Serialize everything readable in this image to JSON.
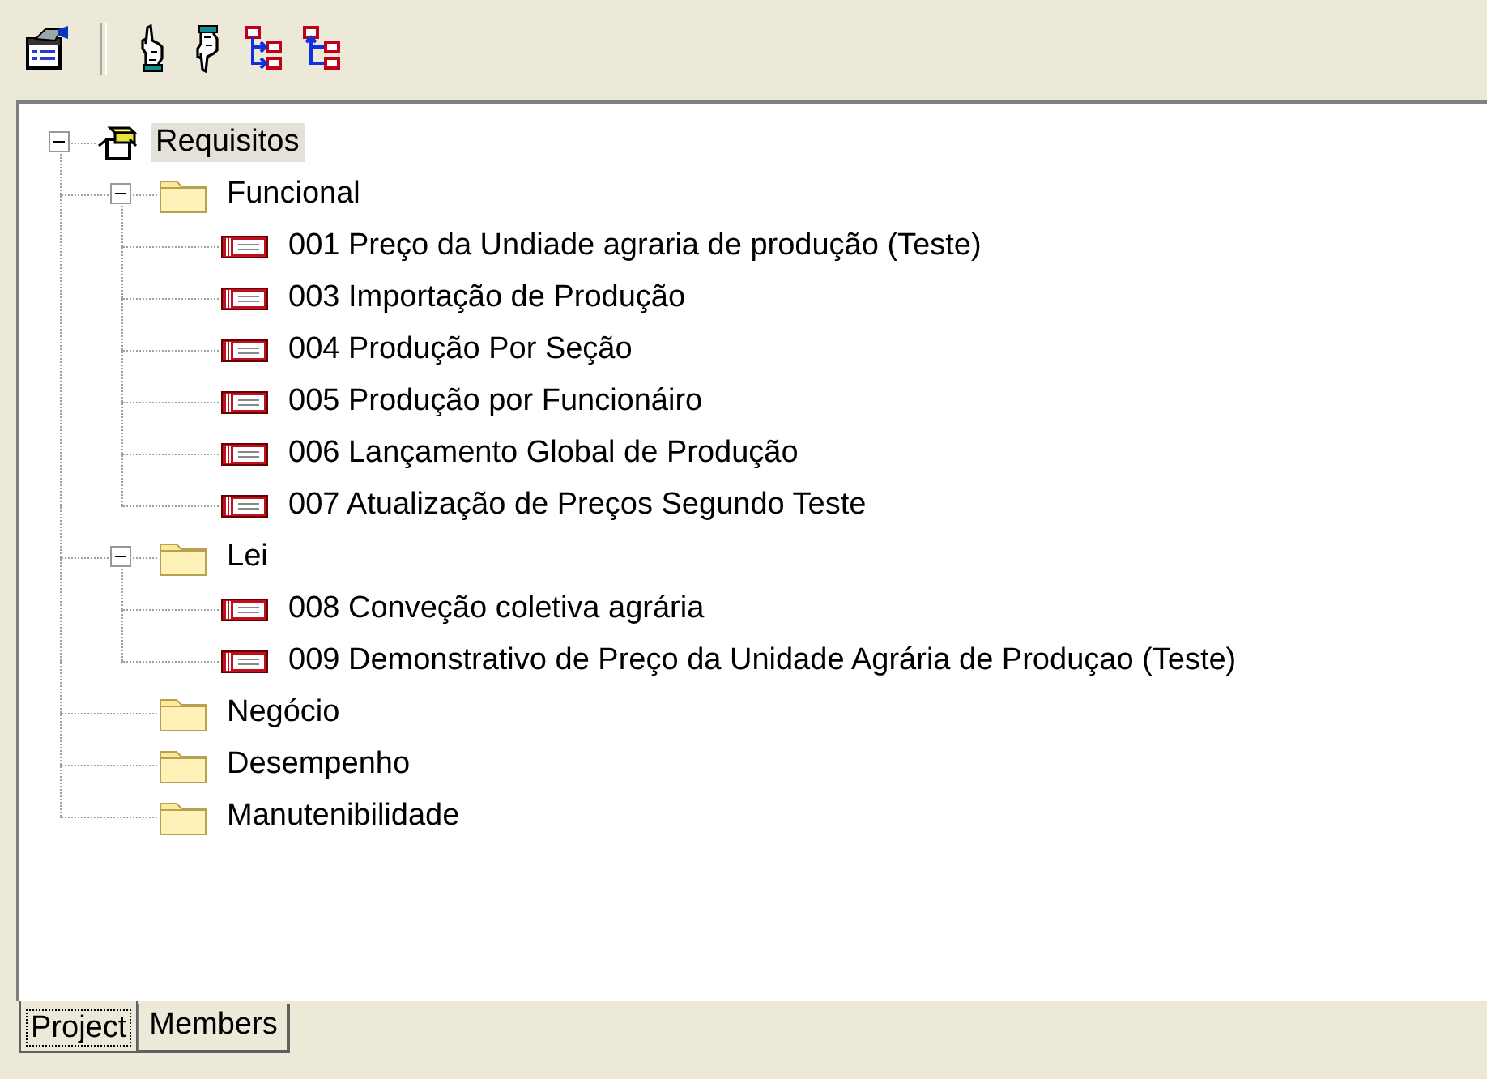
{
  "toolbar": {
    "buttons": [
      {
        "kind": "properties"
      },
      {
        "kind": "separator"
      },
      {
        "kind": "hand-up"
      },
      {
        "kind": "hand-down"
      },
      {
        "kind": "tree-down"
      },
      {
        "kind": "tree-up"
      }
    ]
  },
  "tree": {
    "label": "Requisitos",
    "kind": "root",
    "selected": true,
    "expanded": true,
    "children": [
      {
        "label": "Funcional",
        "kind": "folder",
        "selected": false,
        "expanded": true,
        "children": [
          {
            "label": "001 Preço da Undiade agraria de produção (Teste)",
            "kind": "requirement",
            "selected": false
          },
          {
            "label": "003 Importação de Produção",
            "kind": "requirement",
            "selected": false
          },
          {
            "label": "004 Produção Por Seção",
            "kind": "requirement",
            "selected": false
          },
          {
            "label": "005 Produção por Funcionáiro",
            "kind": "requirement",
            "selected": false
          },
          {
            "label": "006 Lançamento Global de Produção",
            "kind": "requirement",
            "selected": false
          },
          {
            "label": "007 Atualização de Preços Segundo Teste",
            "kind": "requirement",
            "selected": false
          }
        ]
      },
      {
        "label": "Lei",
        "kind": "folder",
        "selected": false,
        "expanded": true,
        "children": [
          {
            "label": "008 Conveção coletiva agrária",
            "kind": "requirement",
            "selected": false
          },
          {
            "label": "009 Demonstrativo de Preço da Unidade Agrária de Produçao (Teste)",
            "kind": "requirement",
            "selected": false
          }
        ]
      },
      {
        "label": "Negócio",
        "kind": "folder",
        "selected": false
      },
      {
        "label": "Desempenho",
        "kind": "folder",
        "selected": false
      },
      {
        "label": "Manutenibilidade",
        "kind": "folder",
        "selected": false
      }
    ]
  },
  "tabs": [
    {
      "label": "Project",
      "selected": true
    },
    {
      "label": "Members",
      "selected": false
    }
  ]
}
